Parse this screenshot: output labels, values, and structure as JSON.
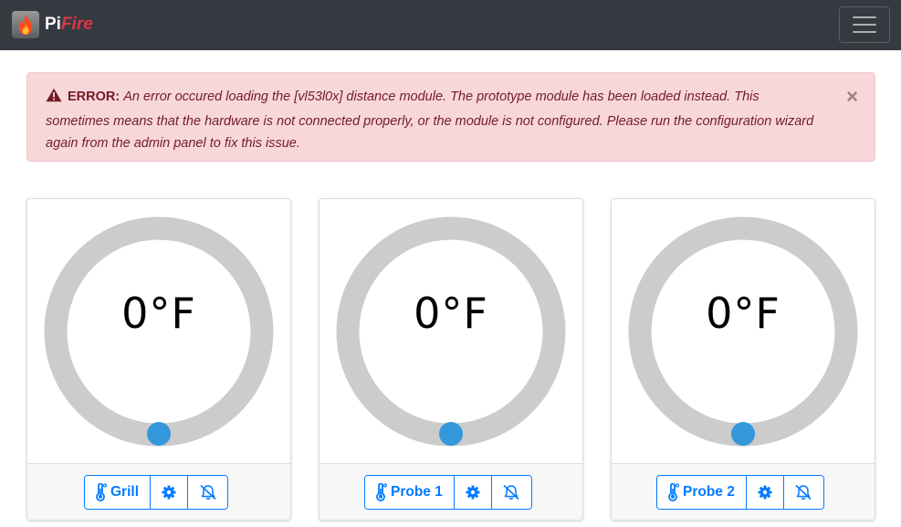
{
  "app": {
    "brand_pi": "Pi",
    "brand_fire": "Fire"
  },
  "alert": {
    "label": "ERROR:",
    "message": "An error occured loading the [vl53l0x] distance module. The prototype module has been loaded instead. This sometimes means that the hardware is not connected properly, or the module is not configured. Please run the configuration wizard again from the admin panel to fix this issue.",
    "close": "×"
  },
  "probes": [
    {
      "temp": "0°F",
      "label": "Grill",
      "level": 0
    },
    {
      "temp": "0°F",
      "label": "Probe 1",
      "level": 0
    },
    {
      "temp": "0°F",
      "label": "Probe 2",
      "level": 0
    }
  ],
  "icons": {
    "logo": "fire-icon",
    "alert": "warning-triangle-icon",
    "probe_button": "thermometer-icon",
    "settings": "gear-icon",
    "notify": "bell-slash-icon",
    "menu": "hamburger-icon"
  },
  "colors": {
    "navbar": "#343a40",
    "accent": "#007bff",
    "gauge_track": "#cccccc",
    "gauge_knob": "#3498db",
    "alert_bg": "#f8d7da",
    "alert_text": "#721c24"
  }
}
